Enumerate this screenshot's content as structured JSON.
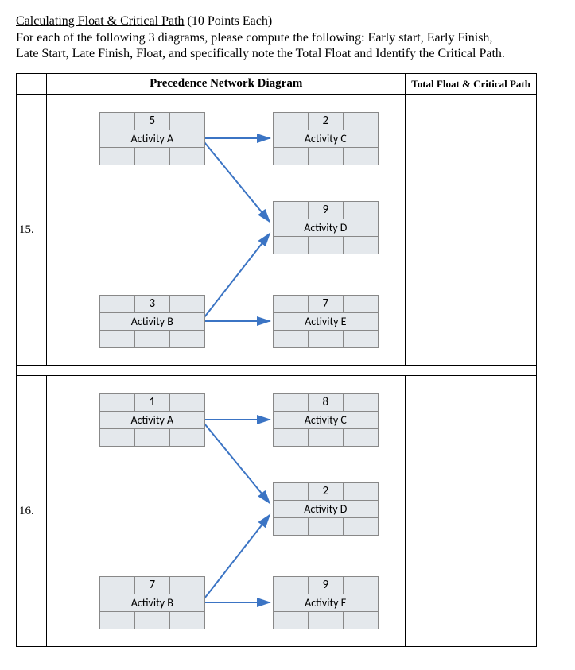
{
  "header": {
    "title_underlined": "Calculating Float & Critical Path",
    "title_rest": " (10 Points Each)",
    "instructions_line1": "For each of the following 3 diagrams, please compute the following: Early start, Early Finish,",
    "instructions_line2": "Late Start, Late Finish, Float, and specifically note the Total Float and Identify the Critical Path."
  },
  "columns": {
    "col1_blank": "",
    "col2": "Precedence Network Diagram",
    "col3": "Total Float & Critical Path"
  },
  "questions": [
    {
      "number": "15.",
      "activities": {
        "A": {
          "label": "Activity A",
          "duration": "5"
        },
        "B": {
          "label": "Activity B",
          "duration": "3"
        },
        "C": {
          "label": "Activity C",
          "duration": "2"
        },
        "D": {
          "label": "Activity D",
          "duration": "9"
        },
        "E": {
          "label": "Activity E",
          "duration": "7"
        }
      }
    },
    {
      "number": "16.",
      "activities": {
        "A": {
          "label": "Activity A",
          "duration": "1"
        },
        "B": {
          "label": "Activity B",
          "duration": "7"
        },
        "C": {
          "label": "Activity C",
          "duration": "8"
        },
        "D": {
          "label": "Activity D",
          "duration": "2"
        },
        "E": {
          "label": "Activity E",
          "duration": "9"
        }
      }
    }
  ]
}
